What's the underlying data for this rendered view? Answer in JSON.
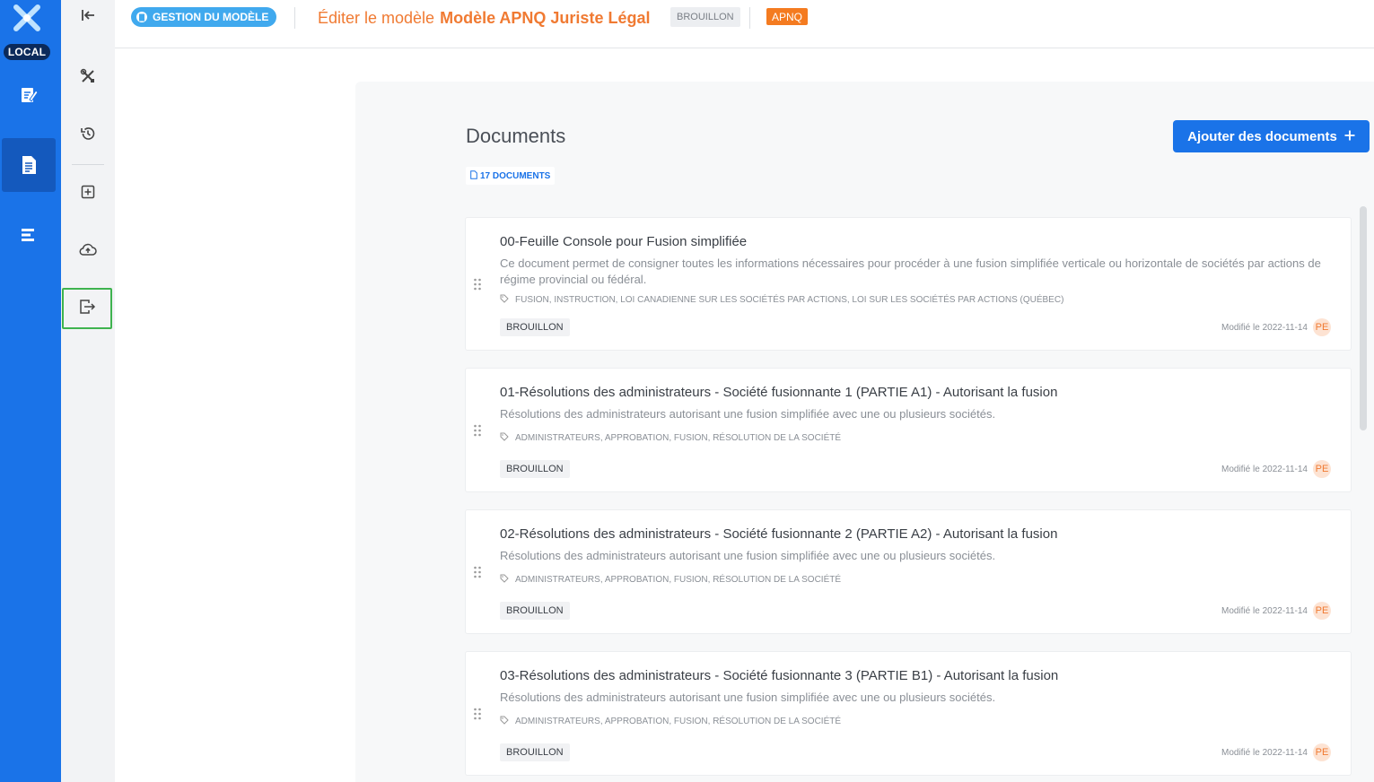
{
  "app": {
    "env_badge": "LOCAL"
  },
  "header": {
    "section_label": "GESTION DU MODÈLE",
    "title_prefix": "Éditer le modèle",
    "model_name": "Modèle APNQ Juriste Légal",
    "status_badge": "BROUILLON",
    "org_badge": "APNQ"
  },
  "main": {
    "title": "Documents",
    "add_button_label": "Ajouter des documents",
    "count_label": "17 DOCUMENTS"
  },
  "documents": [
    {
      "title": "00-Feuille Console pour Fusion simplifiée",
      "description": "Ce document permet de consigner toutes les informations nécessaires pour procéder à une fusion simplifiée verticale ou horizontale de sociétés par actions de régime provincial ou fédéral.",
      "tags": "FUSION, INSTRUCTION, LOI CANADIENNE SUR LES SOCIÉTÉS PAR ACTIONS, LOI SUR LES SOCIÉTÉS PAR ACTIONS (QUÉBEC)",
      "status": "BROUILLON",
      "modified": "Modifié le 2022-11-14",
      "avatar": "PE"
    },
    {
      "title": "01-Résolutions des administrateurs - Société fusionnante 1 (PARTIE A1) - Autorisant la fusion",
      "description": "Résolutions des administrateurs autorisant une fusion simplifiée avec une ou plusieurs sociétés.",
      "tags": "ADMINISTRATEURS, APPROBATION, FUSION, RÉSOLUTION DE LA SOCIÉTÉ",
      "status": "BROUILLON",
      "modified": "Modifié le 2022-11-14",
      "avatar": "PE"
    },
    {
      "title": "02-Résolutions des administrateurs - Société fusionnante 2 (PARTIE A2) - Autorisant la fusion",
      "description": "Résolutions des administrateurs autorisant une fusion simplifiée avec une ou plusieurs sociétés.",
      "tags": "ADMINISTRATEURS, APPROBATION, FUSION, RÉSOLUTION DE LA SOCIÉTÉ",
      "status": "BROUILLON",
      "modified": "Modifié le 2022-11-14",
      "avatar": "PE"
    },
    {
      "title": "03-Résolutions des administrateurs - Société fusionnante 3 (PARTIE B1) - Autorisant la fusion",
      "description": "Résolutions des administrateurs autorisant une fusion simplifiée avec une ou plusieurs sociétés.",
      "tags": "ADMINISTRATEURS, APPROBATION, FUSION, RÉSOLUTION DE LA SOCIÉTÉ",
      "status": "BROUILLON",
      "modified": "Modifié le 2022-11-14",
      "avatar": "PE"
    }
  ],
  "colors": {
    "brand_blue": "#1a73e8",
    "accent_orange": "#f07a32",
    "highlight_green": "#3fb34f"
  },
  "icons": {
    "rail": [
      "app-logo-icon",
      "edit-document-icon",
      "document-list-icon",
      "align-left-icon"
    ],
    "tools": [
      "collapse-icon",
      "tools-icon",
      "history-icon",
      "add-box-icon",
      "cloud-upload-icon",
      "export-icon"
    ]
  }
}
